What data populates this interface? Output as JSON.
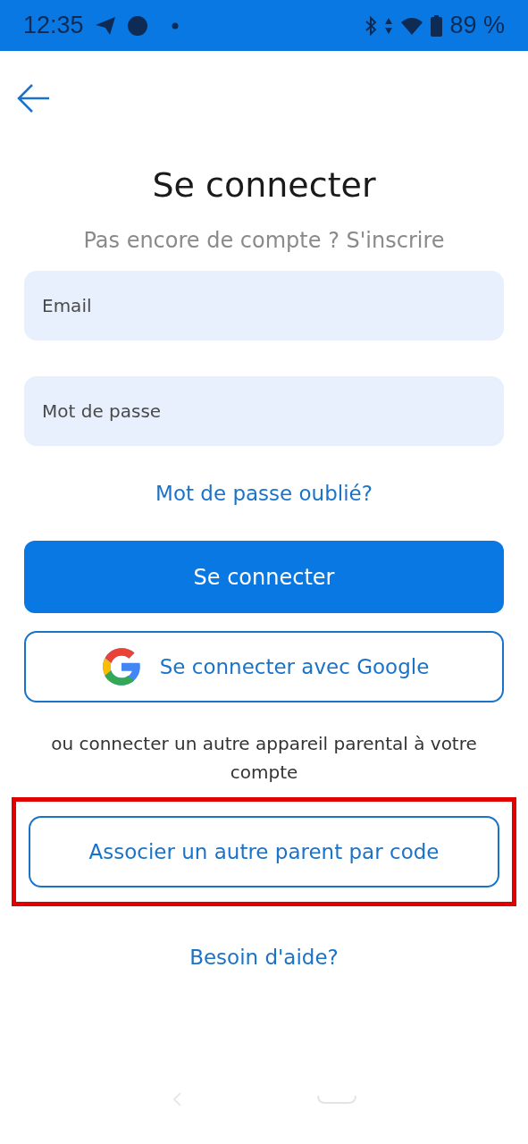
{
  "status_bar": {
    "time": "12:35",
    "battery": "89 %"
  },
  "title": "Se connecter",
  "signup_prompt": "Pas encore de compte ? S'inscrire",
  "fields": [
    {
      "placeholder": "Email"
    },
    {
      "placeholder": "Mot de passe"
    }
  ],
  "forgot_link": "Mot de passe oublié?",
  "login_button": "Se connecter",
  "google_button": "Se connecter avec Google",
  "other_device_text": "ou connecter un autre appareil parental à votre compte",
  "associate_button": {
    "label": "Associer un autre parent par code",
    "highlighted": true
  },
  "help_link": "Besoin d'aide?"
}
